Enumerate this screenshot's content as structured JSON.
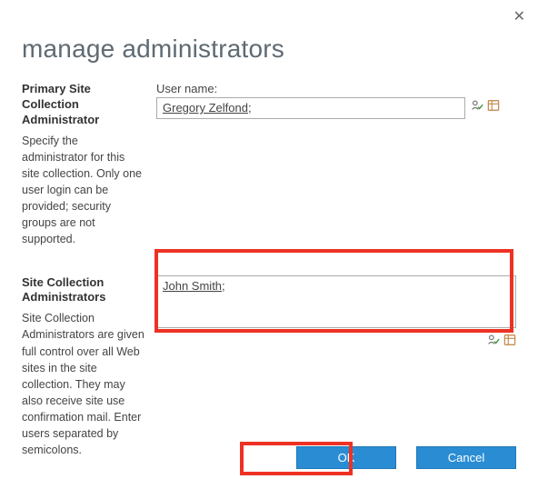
{
  "dialog": {
    "title": "manage administrators",
    "close_symbol": "✕"
  },
  "primary": {
    "heading": "Primary Site Collection Administrator",
    "desc": "Specify the administrator for this site collection. Only one user login can be provided; security groups are not supported.",
    "field_label": "User name:",
    "value": "Gregory Zelfond",
    "separator": ";"
  },
  "secondary": {
    "heading": "Site Collection Administrators",
    "desc": "Site Collection Administrators are given full control over all Web sites in the site collection. They may also receive site use confirmation mail. Enter users separated by semicolons.",
    "value": "John Smith",
    "separator": ";"
  },
  "buttons": {
    "ok": "OK",
    "cancel": "Cancel"
  },
  "colors": {
    "accent": "#2a8dd4",
    "highlight_border": "#ee3124"
  }
}
